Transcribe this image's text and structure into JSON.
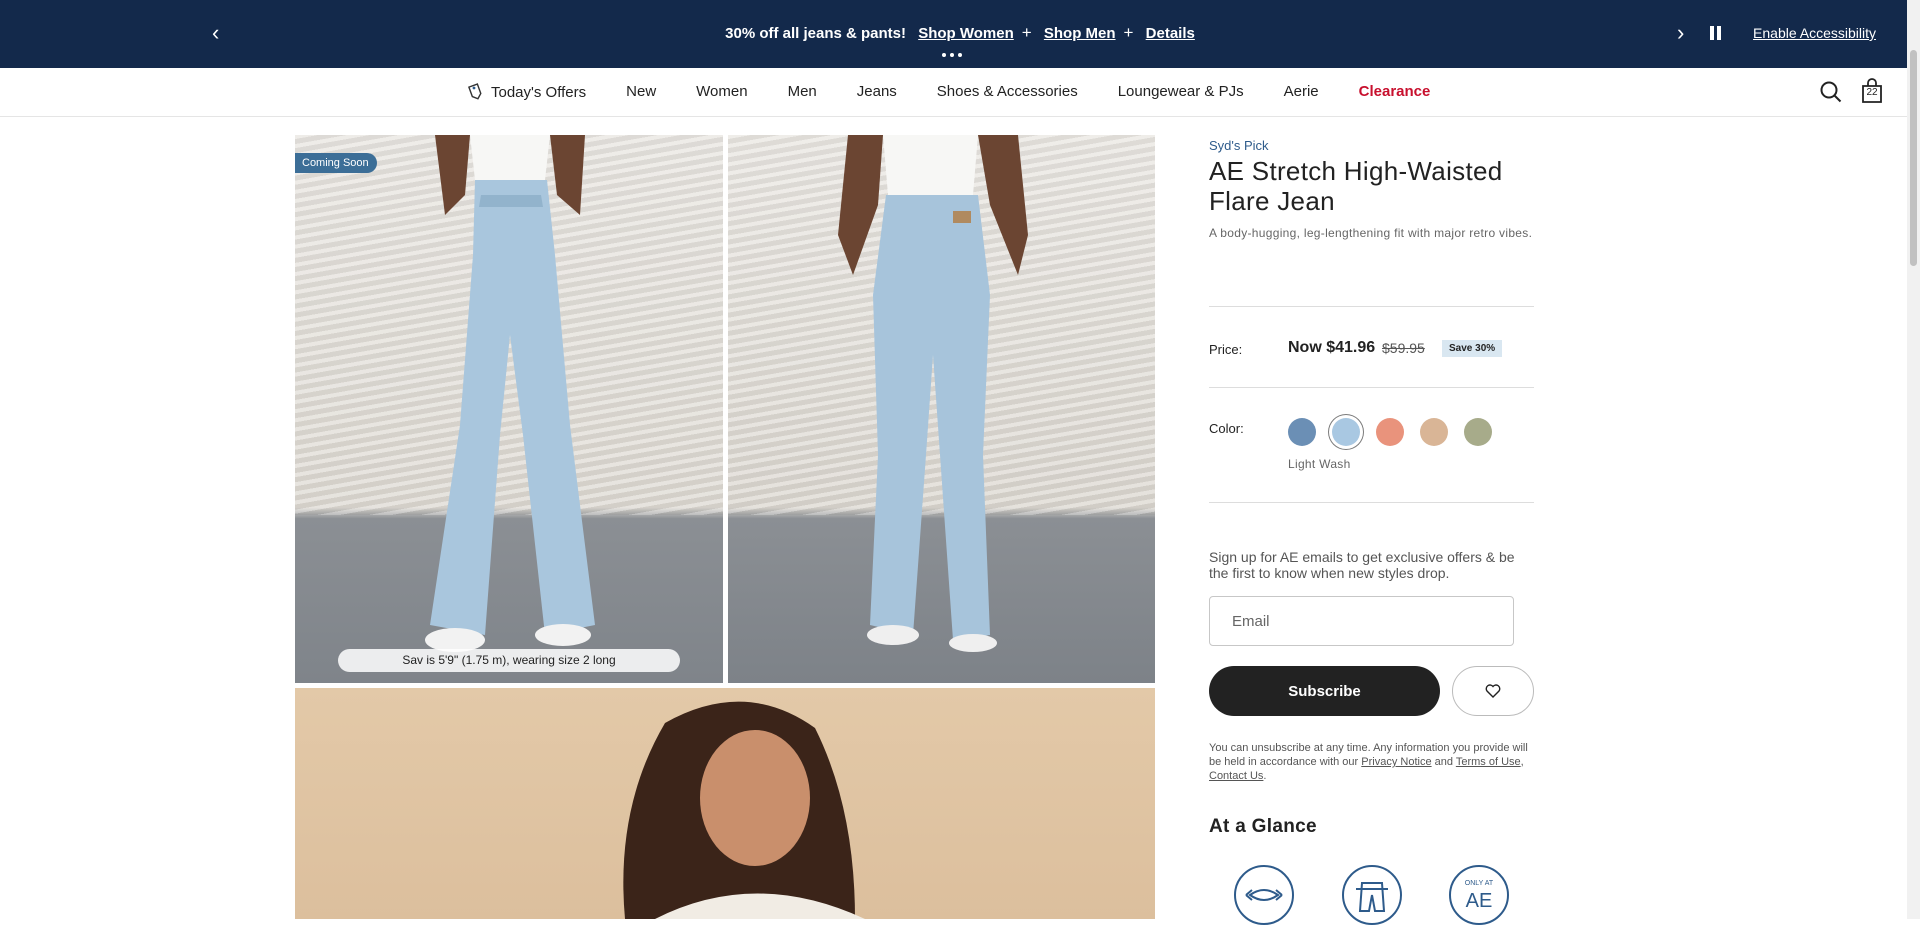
{
  "promo": {
    "headline": "30% off all jeans & pants!",
    "links": [
      "Shop Women",
      "Shop Men"
    ],
    "details": "Details",
    "accessibility": "Enable Accessibility",
    "background": "#13294b"
  },
  "nav": {
    "items": [
      "Today's Offers",
      "New",
      "Women",
      "Men",
      "Jeans",
      "Shoes & Accessories",
      "Loungewear & PJs",
      "Aerie",
      "Clearance"
    ],
    "clearance_color": "#c8102e",
    "bag_count": "22"
  },
  "images": {
    "badge": "Coming Soon",
    "caption": "Sav is 5'9\" (1.75 m), wearing size 2 long"
  },
  "product": {
    "pick": "Syd's Pick",
    "title": "AE Stretch High-Waisted Flare Jean",
    "description": "A body-hugging, leg-lengthening fit with major retro vibes.",
    "price_label": "Price:",
    "price_now": "Now $41.96",
    "price_was": "$59.95",
    "save": "Save 30%",
    "color_label": "Color:",
    "colors": [
      "#6b8fb5",
      "#a9c8e2",
      "#e9937c",
      "#d9b596",
      "#a7ab8a"
    ],
    "selected_color": "Light Wash"
  },
  "signup": {
    "text": "Sign up for AE emails to get exclusive offers & be the first to know when new styles drop.",
    "placeholder": "Email",
    "button": "Subscribe",
    "legal_prefix": "You can unsubscribe at any time. Any information you provide will be held in accordance with our",
    "privacy": "Privacy Notice",
    "and": "and",
    "terms": "Terms of Use",
    "contact": "Contact Us"
  },
  "glance": {
    "title": "At a Glance",
    "icons": [
      "stretch-icon",
      "fit-icon",
      "only-at-ae-icon"
    ],
    "only_at_text": "ONLY AT",
    "ae_text": "AE"
  }
}
